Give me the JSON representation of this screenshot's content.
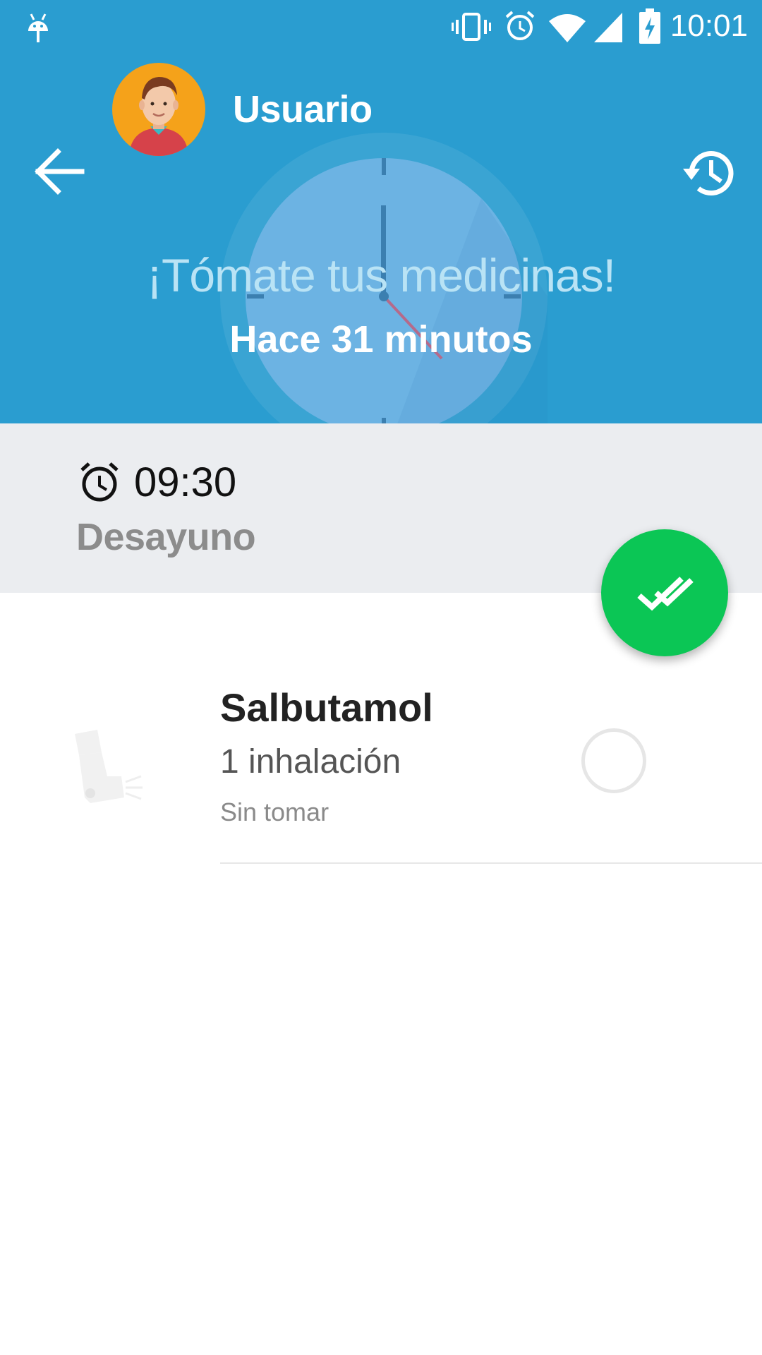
{
  "status_bar": {
    "time": "10:01",
    "icons": [
      "android-debug-icon",
      "vibrate-icon",
      "alarm-icon",
      "wifi-icon",
      "signal-icon",
      "battery-charging-icon"
    ]
  },
  "header": {
    "user_name": "Usuario",
    "title": "¡Tómate tus medicinas!",
    "subtitle": "Hace 31 minutos",
    "back_icon": "arrow-back-icon",
    "history_icon": "history-icon",
    "background_color": "#2a9dd0"
  },
  "schedule": {
    "time": "09:30",
    "label": "Desayuno",
    "icon": "alarm-clock-icon"
  },
  "fab": {
    "icon": "double-check-icon",
    "color": "#0bc655"
  },
  "medications": [
    {
      "name": "Salbutamol",
      "dose": "1 inhalación",
      "status": "Sin tomar",
      "icon": "inhaler-icon"
    }
  ]
}
